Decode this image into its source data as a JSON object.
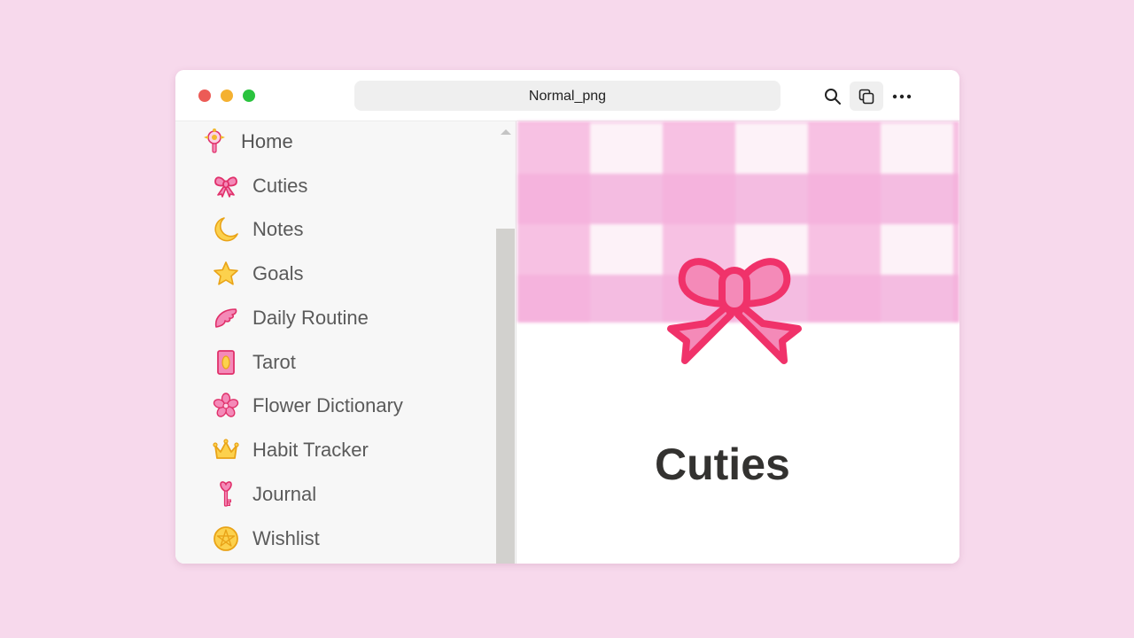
{
  "window": {
    "url_title": "Normal_png"
  },
  "toolbar": {
    "icons": [
      "search-icon",
      "copy-icon",
      "more-icon"
    ]
  },
  "sidebar": {
    "items": [
      {
        "label": "Home",
        "icon": "magic-wand-icon"
      },
      {
        "label": "Cuties",
        "icon": "bow-icon"
      },
      {
        "label": "Notes",
        "icon": "crescent-moon-icon"
      },
      {
        "label": "Goals",
        "icon": "star-icon"
      },
      {
        "label": "Daily Routine",
        "icon": "wing-icon"
      },
      {
        "label": "Tarot",
        "icon": "tarot-card-icon"
      },
      {
        "label": "Flower Dictionary",
        "icon": "cherry-blossom-icon"
      },
      {
        "label": "Habit Tracker",
        "icon": "crown-icon"
      },
      {
        "label": "Journal",
        "icon": "heart-key-icon"
      },
      {
        "label": "Wishlist",
        "icon": "pentagram-coin-icon"
      }
    ]
  },
  "page": {
    "title": "Cuties",
    "icon": "bow-icon",
    "banner": "pink-gingham-pattern"
  },
  "colors": {
    "background": "#f7d9ec",
    "accent_pink": "#f0326a",
    "bow_fill": "#f48ab8",
    "gold": "#f2b82e"
  }
}
